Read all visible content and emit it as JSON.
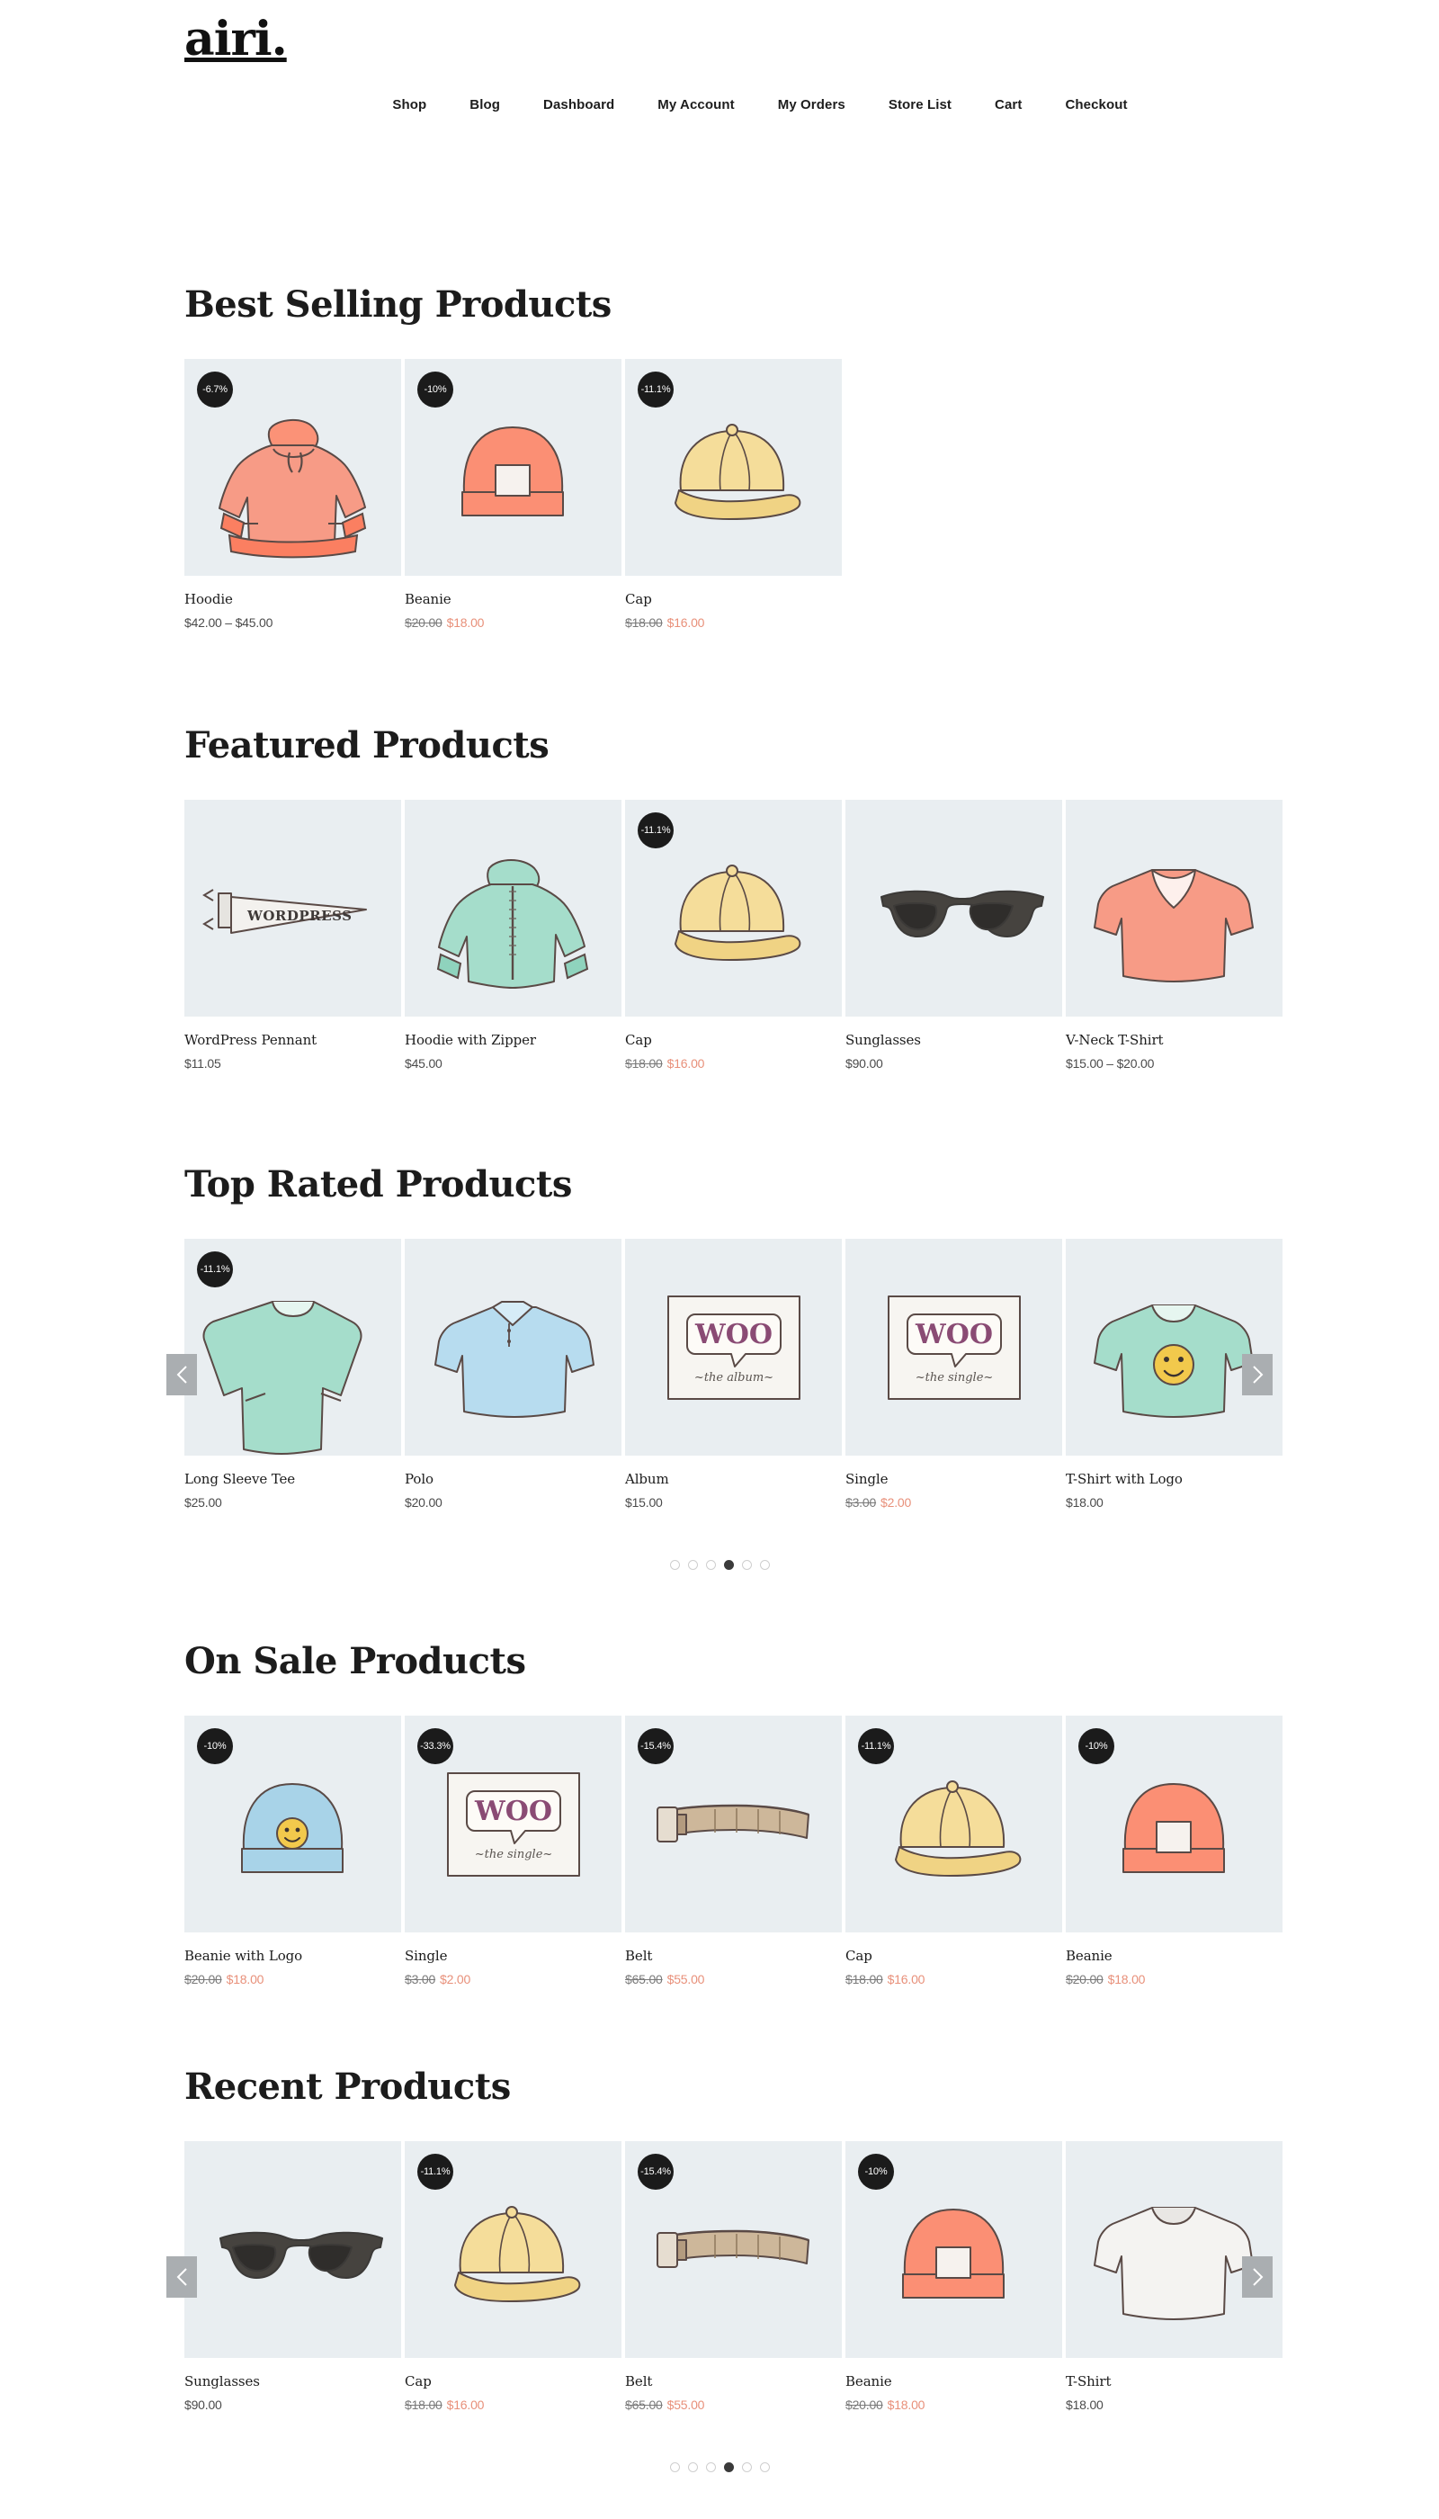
{
  "header": {
    "logo": "airi.",
    "nav": [
      {
        "label": "Shop"
      },
      {
        "label": "Blog"
      },
      {
        "label": "Dashboard"
      },
      {
        "label": "My Account"
      },
      {
        "label": "My Orders"
      },
      {
        "label": "Store List"
      },
      {
        "label": "Cart"
      },
      {
        "label": "Checkout"
      }
    ]
  },
  "colors": {
    "sale_price": "#e8907a",
    "thumb_bg": "#e9eef1",
    "badge_bg": "#1b1b1b",
    "arrow_bg": "#aaaeb1"
  },
  "sections": [
    {
      "id": "best-selling",
      "title": "Best Selling Products",
      "carousel": false,
      "products": [
        {
          "name": "Hoodie",
          "badge": "-6.7%",
          "price": "$42.00 – $45.00",
          "old_price": "",
          "new_price": "",
          "art": "hoodie"
        },
        {
          "name": "Beanie",
          "badge": "-10%",
          "price": "",
          "old_price": "$20.00",
          "new_price": "$18.00",
          "art": "beanie"
        },
        {
          "name": "Cap",
          "badge": "-11.1%",
          "price": "",
          "old_price": "$18.00",
          "new_price": "$16.00",
          "art": "cap"
        }
      ]
    },
    {
      "id": "featured",
      "title": "Featured Products",
      "carousel": false,
      "products": [
        {
          "name": "WordPress Pennant",
          "badge": "",
          "price": "$11.05",
          "old_price": "",
          "new_price": "",
          "art": "pennant"
        },
        {
          "name": "Hoodie with Zipper",
          "badge": "",
          "price": "$45.00",
          "old_price": "",
          "new_price": "",
          "art": "hoodie-zipper"
        },
        {
          "name": "Cap",
          "badge": "-11.1%",
          "price": "",
          "old_price": "$18.00",
          "new_price": "$16.00",
          "art": "cap"
        },
        {
          "name": "Sunglasses",
          "badge": "",
          "price": "$90.00",
          "old_price": "",
          "new_price": "",
          "art": "sunglasses"
        },
        {
          "name": "V-Neck T-Shirt",
          "badge": "",
          "price": "$15.00 – $20.00",
          "old_price": "",
          "new_price": "",
          "art": "vneck"
        }
      ]
    },
    {
      "id": "top-rated",
      "title": "Top Rated Products",
      "carousel": true,
      "dots": {
        "count": 6,
        "active": 3
      },
      "products": [
        {
          "name": "Long Sleeve Tee",
          "badge": "-11.1%",
          "price": "$25.00",
          "old_price": "",
          "new_price": "",
          "art": "longsleeve"
        },
        {
          "name": "Polo",
          "badge": "",
          "price": "$20.00",
          "old_price": "",
          "new_price": "",
          "art": "polo"
        },
        {
          "name": "Album",
          "badge": "",
          "price": "$15.00",
          "old_price": "",
          "new_price": "",
          "art": "album"
        },
        {
          "name": "Single",
          "badge": "",
          "price": "",
          "old_price": "$3.00",
          "new_price": "$2.00",
          "art": "single"
        },
        {
          "name": "T-Shirt with Logo",
          "badge": "",
          "price": "$18.00",
          "old_price": "",
          "new_price": "",
          "art": "tshirt-logo"
        }
      ]
    },
    {
      "id": "on-sale",
      "title": "On Sale Products",
      "carousel": false,
      "products": [
        {
          "name": "Beanie with Logo",
          "badge": "-10%",
          "price": "",
          "old_price": "$20.00",
          "new_price": "$18.00",
          "art": "beanie-logo"
        },
        {
          "name": "Single",
          "badge": "-33.3%",
          "price": "",
          "old_price": "$3.00",
          "new_price": "$2.00",
          "art": "single"
        },
        {
          "name": "Belt",
          "badge": "-15.4%",
          "price": "",
          "old_price": "$65.00",
          "new_price": "$55.00",
          "art": "belt"
        },
        {
          "name": "Cap",
          "badge": "-11.1%",
          "price": "",
          "old_price": "$18.00",
          "new_price": "$16.00",
          "art": "cap"
        },
        {
          "name": "Beanie",
          "badge": "-10%",
          "price": "",
          "old_price": "$20.00",
          "new_price": "$18.00",
          "art": "beanie"
        }
      ]
    },
    {
      "id": "recent",
      "title": "Recent Products",
      "carousel": true,
      "dots": {
        "count": 6,
        "active": 3
      },
      "products": [
        {
          "name": "Sunglasses",
          "badge": "",
          "price": "$90.00",
          "old_price": "",
          "new_price": "",
          "art": "sunglasses"
        },
        {
          "name": "Cap",
          "badge": "-11.1%",
          "price": "",
          "old_price": "$18.00",
          "new_price": "$16.00",
          "art": "cap"
        },
        {
          "name": "Belt",
          "badge": "-15.4%",
          "price": "",
          "old_price": "$65.00",
          "new_price": "$55.00",
          "art": "belt"
        },
        {
          "name": "Beanie",
          "badge": "-10%",
          "price": "",
          "old_price": "$20.00",
          "new_price": "$18.00",
          "art": "beanie"
        },
        {
          "name": "T-Shirt",
          "badge": "",
          "price": "$18.00",
          "old_price": "",
          "new_price": "",
          "art": "tshirt"
        }
      ]
    }
  ],
  "carousel_controls": {
    "prev_icon": "chevron-left-icon",
    "next_icon": "chevron-right-icon"
  }
}
